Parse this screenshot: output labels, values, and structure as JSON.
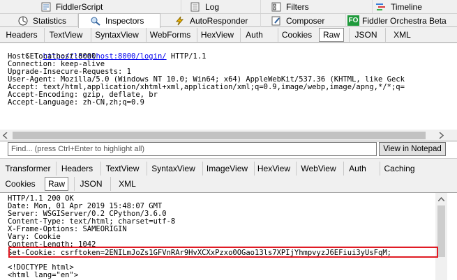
{
  "top_tabs_row1": [
    {
      "label": "FiddlerScript",
      "icon": "fiddlerscript-icon"
    },
    {
      "label": "Log",
      "icon": "log-icon"
    },
    {
      "label": "Filters",
      "icon": "filters-icon"
    },
    {
      "label": "Timeline",
      "icon": "timeline-icon"
    }
  ],
  "top_tabs_row2": [
    {
      "label": "Statistics",
      "icon": "statistics-icon"
    },
    {
      "label": "Inspectors",
      "icon": "inspectors-icon",
      "active": true
    },
    {
      "label": "AutoResponder",
      "icon": "autoresponder-icon"
    },
    {
      "label": "Composer",
      "icon": "composer-icon"
    },
    {
      "label": "Fiddler Orchestra Beta",
      "icon": "fiddler-orchestra-icon",
      "icon_text": "FO"
    }
  ],
  "request_tabs": [
    "Headers",
    "TextView",
    "SyntaxView",
    "WebForms",
    "HexView",
    "Auth",
    "Cookies",
    "Raw",
    "JSON",
    "XML"
  ],
  "request_selected": "Raw",
  "request_lines": {
    "l1_pre": "GET ",
    "l1_link": "http://localhost:8000/login/",
    "l1_post": " HTTP/1.1",
    "l2": "Host: localhost:8000",
    "l3": "Connection: keep-alive",
    "l4": "Upgrade-Insecure-Requests: 1",
    "l5": "User-Agent: Mozilla/5.0 (Windows NT 10.0; Win64; x64) AppleWebKit/537.36 (KHTML, like Geck",
    "l6": "Accept: text/html,application/xhtml+xml,application/xml;q=0.9,image/webp,image/apng,*/*;q=",
    "l7": "Accept-Encoding: gzip, deflate, br",
    "l8": "Accept-Language: zh-CN,zh;q=0.9"
  },
  "find": {
    "placeholder": "Find... (press Ctrl+Enter to highlight all)",
    "button": "View in Notepad"
  },
  "response_tabs_row1": [
    "Transformer",
    "Headers",
    "TextView",
    "SyntaxView",
    "ImageView",
    "HexView",
    "WebView",
    "Auth",
    "Caching"
  ],
  "response_tabs_row2": [
    "Cookies",
    "Raw",
    "JSON",
    "XML"
  ],
  "response_selected": "Raw",
  "response_lines": {
    "l1": "HTTP/1.1 200 OK",
    "l2": "Date: Mon, 01 Apr 2019 15:48:07 GMT",
    "l3": "Server: WSGIServer/0.2 CPython/3.6.0",
    "l4": "Content-Type: text/html; charset=utf-8",
    "l5": "X-Frame-Options: SAMEORIGIN",
    "l6": "Vary: Cookie",
    "l7": "Content-Length: 1042",
    "l8": "Set-Cookie: csrftoken=2ENILmJoZs1GFVnRAr9HvXCXxPzxo0OGao13ls7XPIjYhmpvyzJ6EFiui3yUsFqM;",
    "l9": "",
    "l10": "<!DOCTYPE html>",
    "l11": "<html lang=\"en\">"
  },
  "colors": {
    "highlight": "#e01b24",
    "link": "#0000ee",
    "chrome": "#f0f0f0"
  }
}
